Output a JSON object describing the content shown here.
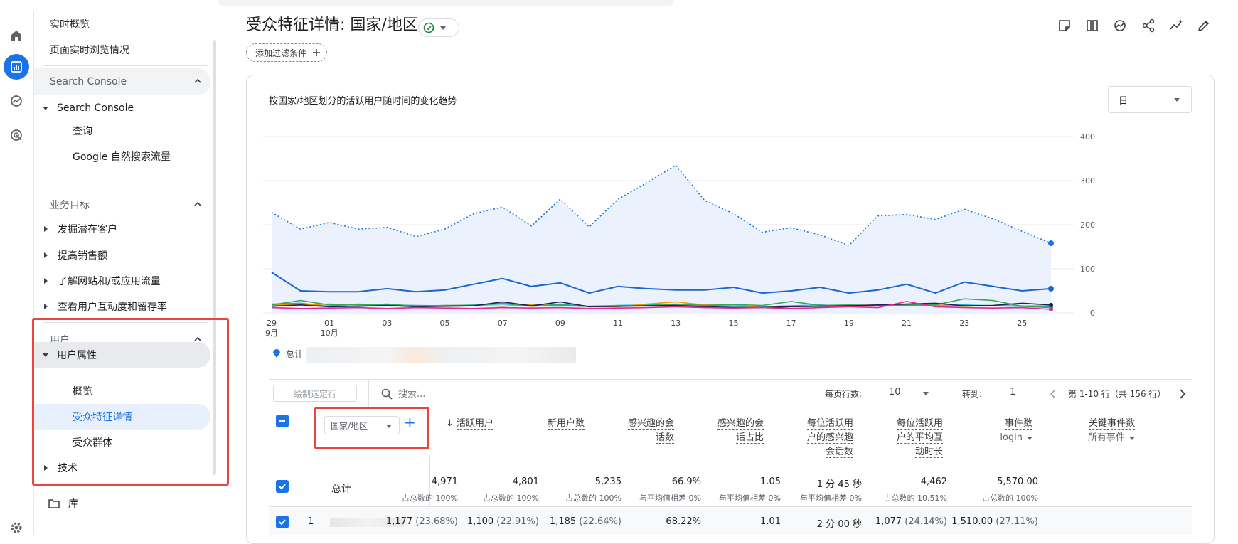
{
  "sidebar": {
    "realtime_overview": "实时概览",
    "realtime_pages": "页面实时浏览情况",
    "search_console_section": "Search Console",
    "search_console_group": "Search Console",
    "queries": "查询",
    "organic": "Google 自然搜索流量",
    "business_section": "业务目标",
    "biz_items": [
      "发掘潜在客户",
      "提高销售额",
      "了解网站和/或应用流量",
      "查看用户互动度和留存率"
    ],
    "user_section": "用户",
    "user_attributes": "用户属性",
    "overview": "概览",
    "demographic_details": "受众特征详情",
    "audiences": "受众群体",
    "tech": "技术",
    "library": "库"
  },
  "header": {
    "title": "受众特征详情: 国家/地区",
    "add_filter": "添加过滤条件"
  },
  "chart_header": {
    "title": "按国家/地区划分的活跃用户随时间的变化趋势",
    "period": "日"
  },
  "chart_data": {
    "type": "line",
    "title": "按国家/地区划分的活跃用户随时间的变化趋势",
    "x": [
      "29",
      "30",
      "01",
      "02",
      "03",
      "04",
      "05",
      "06",
      "07",
      "08",
      "09",
      "10",
      "11",
      "12",
      "13",
      "14",
      "15",
      "16",
      "17",
      "18",
      "19",
      "20",
      "21",
      "22",
      "23",
      "24",
      "25",
      "26"
    ],
    "x_tick_labels": [
      "29",
      "01",
      "03",
      "05",
      "07",
      "09",
      "11",
      "13",
      "15",
      "17",
      "19",
      "21",
      "23",
      "25"
    ],
    "month_labels": [
      "9月",
      "10月"
    ],
    "y_ticks": [
      "400",
      "300",
      "200",
      "100",
      "0"
    ],
    "ylim": [
      0,
      400
    ],
    "legend": [
      "总计"
    ],
    "series": [
      {
        "name": "总计",
        "color": "#1a73e8",
        "values": [
          228,
          190,
          205,
          190,
          194,
          173,
          190,
          225,
          240,
          197,
          258,
          195,
          258,
          295,
          335,
          255,
          225,
          183,
          193,
          177,
          153,
          220,
          223,
          212,
          235,
          213,
          185,
          158
        ]
      },
      {
        "color": "#1967d2",
        "values": [
          92,
          50,
          48,
          48,
          55,
          48,
          52,
          65,
          78,
          60,
          68,
          45,
          60,
          55,
          52,
          52,
          58,
          45,
          50,
          58,
          45,
          52,
          65,
          45,
          70,
          60,
          50,
          55
        ]
      },
      {
        "color": "#12b5cb",
        "values": [
          20,
          22,
          15,
          20,
          18,
          17,
          16,
          18,
          20,
          17,
          20,
          15,
          17,
          18,
          19,
          16,
          15,
          14,
          16,
          18,
          15,
          18,
          17,
          16,
          18,
          16,
          15,
          14
        ]
      },
      {
        "color": "#f29900",
        "values": [
          18,
          18,
          20,
          18,
          16,
          15,
          17,
          17,
          15,
          19,
          16,
          15,
          14,
          20,
          25,
          18,
          18,
          12,
          15,
          16,
          17,
          18,
          20,
          18,
          15,
          17,
          16,
          16
        ]
      },
      {
        "color": "#34a853",
        "values": [
          18,
          28,
          18,
          18,
          20,
          15,
          17,
          17,
          22,
          15,
          18,
          14,
          15,
          17,
          20,
          17,
          19,
          17,
          26,
          17,
          18,
          17,
          18,
          18,
          32,
          28,
          15,
          12
        ]
      },
      {
        "color": "#1f1f5c",
        "values": [
          15,
          18,
          14,
          15,
          17,
          14,
          15,
          16,
          25,
          16,
          25,
          14,
          15,
          16,
          17,
          14,
          12,
          12,
          14,
          15,
          16,
          18,
          20,
          22,
          16,
          17,
          22,
          18
        ]
      },
      {
        "color": "#e52592",
        "values": [
          12,
          10,
          11,
          12,
          10,
          12,
          11,
          10,
          12,
          11,
          12,
          10,
          11,
          12,
          14,
          12,
          11,
          12,
          10,
          12,
          14,
          12,
          26,
          14,
          12,
          11,
          12,
          8
        ]
      }
    ]
  },
  "controls": {
    "plot_rows": "绘制选定行",
    "search_placeholder": "搜索...",
    "rows_per_page_label": "每页行数:",
    "rows_per_page": "10",
    "goto_label": "转到:",
    "goto_value": "1",
    "pagination": "第 1-10 行（共 156 行）"
  },
  "table": {
    "dimension": "国家/地区",
    "columns": [
      {
        "l1": "活跃用户"
      },
      {
        "l1": "新用户数"
      },
      {
        "l1": "感兴趣的会",
        "l2": "话数"
      },
      {
        "l1": "感兴趣的会",
        "l2": "话占比"
      },
      {
        "l1": "每位活跃用",
        "l2": "户的感兴趣",
        "l3": "会话数"
      },
      {
        "l1": "每位活跃用",
        "l2": "户的平均互",
        "l3": "动时长"
      },
      {
        "l1": "事件数",
        "sub": "login"
      },
      {
        "l1": "关键事件数",
        "sub": "所有事件"
      }
    ],
    "totals_label": "总计",
    "totals": [
      "4,971",
      "4,801",
      "5,235",
      "66.9%",
      "1.05",
      "1 分 45 秒",
      "4,462",
      "5,570.00"
    ],
    "totals_sub": [
      "占总数的 100%",
      "占总数的 100%",
      "占总数的 100%",
      "与平均值相差 0%",
      "与平均值相差 0%",
      "与平均值相差 0%",
      "占总数的 10.51%",
      "占总数的 100%"
    ],
    "row1": {
      "index": "1",
      "values": [
        "1,177",
        "1,100",
        "1,185",
        "68.22%",
        "1.01",
        "2 分 00 秒",
        "1,077",
        "1,510.00"
      ],
      "pcts": [
        "(23.68%)",
        "(22.91%)",
        "(22.64%)",
        "",
        "",
        "",
        "(24.14%)",
        "(27.11%)"
      ]
    }
  }
}
